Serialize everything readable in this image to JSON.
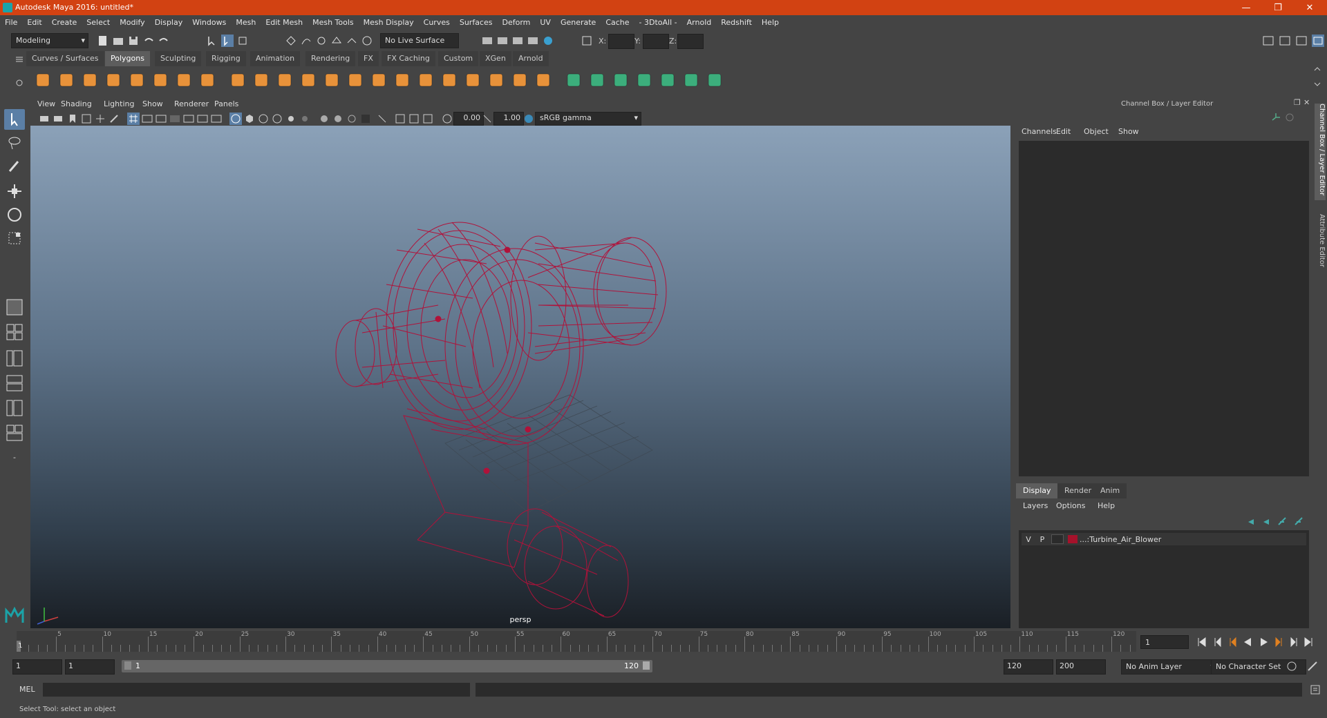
{
  "window": {
    "title": "Autodesk Maya 2016: untitled*"
  },
  "menubar": [
    "File",
    "Edit",
    "Create",
    "Select",
    "Modify",
    "Display",
    "Windows",
    "Mesh",
    "Edit Mesh",
    "Mesh Tools",
    "Mesh Display",
    "Curves",
    "Surfaces",
    "Deform",
    "UV",
    "Generate",
    "Cache",
    "- 3DtoAll -",
    "Arnold",
    "Redshift",
    "Help"
  ],
  "status_line": {
    "menu_set": "Modeling",
    "live_surface": "No Live Surface",
    "x_label": "X:",
    "y_label": "Y:",
    "z_label": "Z:"
  },
  "shelf_tabs": [
    "Curves / Surfaces",
    "Polygons",
    "Sculpting",
    "Rigging",
    "Animation",
    "Rendering",
    "FX",
    "FX Caching",
    "Custom",
    "XGen",
    "Arnold"
  ],
  "shelf_active": "Polygons",
  "viewport": {
    "menu": [
      "View",
      "Shading",
      "Lighting",
      "Show",
      "Renderer",
      "Panels"
    ],
    "exposure": "0.00",
    "gamma": "1.00",
    "color_space": "sRGB gamma",
    "camera_label": "persp",
    "wire_color": "#b0123a"
  },
  "channel_box": {
    "header": "Channel Box / Layer Editor",
    "menu": [
      "Channels",
      "Edit",
      "Object",
      "Show"
    ]
  },
  "side_tabs": [
    "Channel Box / Layer Editor",
    "Attribute Editor"
  ],
  "layer_editor": {
    "tabs": [
      "Display",
      "Render",
      "Anim"
    ],
    "active_tab": "Display",
    "menu": [
      "Layers",
      "Options",
      "Help"
    ],
    "layers": [
      {
        "visible": "V",
        "playback": "P",
        "name": "...:Turbine_Air_Blower",
        "color": "#a5122b"
      }
    ]
  },
  "time_slider": {
    "ticks": [
      "5",
      "10",
      "15",
      "20",
      "25",
      "30",
      "35",
      "40",
      "45",
      "50",
      "55",
      "60",
      "65",
      "70",
      "75",
      "80",
      "85",
      "90",
      "95",
      "100",
      "105",
      "110",
      "115",
      "120"
    ],
    "start_marker": "1",
    "current_frame": "1"
  },
  "range_slider": {
    "start": "1",
    "playback_start": "1",
    "range_start_label": "1",
    "range_end_label": "120",
    "playback_end": "120",
    "end": "200",
    "anim_layer": "No Anim Layer",
    "character_set": "No Character Set"
  },
  "command_line": {
    "label": "MEL"
  },
  "help_line": {
    "text": "Select Tool: select an object"
  }
}
